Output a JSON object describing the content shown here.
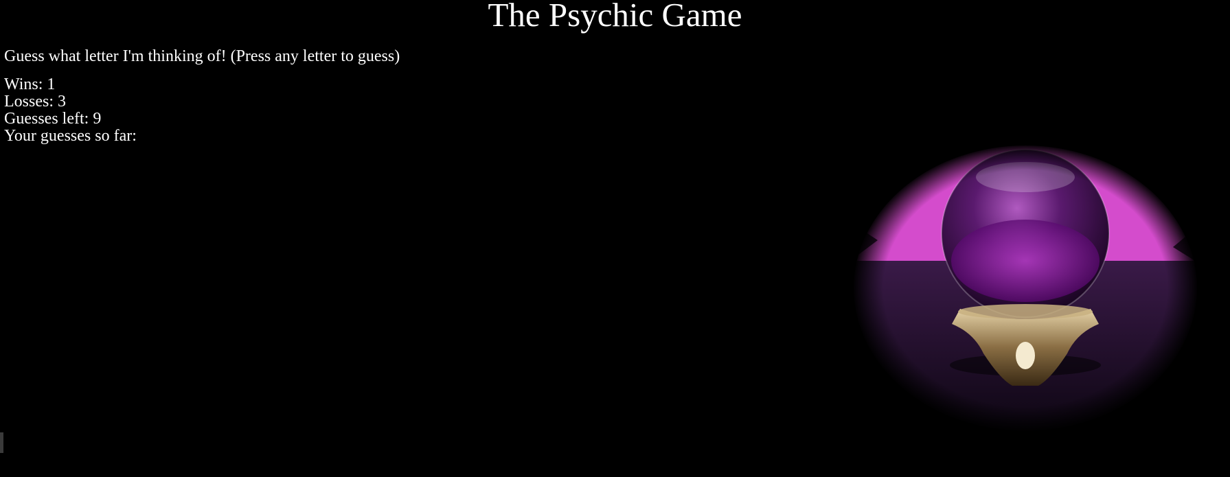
{
  "header": {
    "title": "The Psychic Game"
  },
  "game": {
    "instructions": "Guess what letter I'm thinking of! (Press any letter to guess)",
    "wins_label": "Wins: ",
    "wins": "1",
    "losses_label": "Losses: ",
    "losses": "3",
    "guesses_left_label": "Guesses left: ",
    "guesses_left": "9",
    "guesses_so_far_label": "Your guesses so far:",
    "guesses_so_far": ""
  },
  "image": {
    "icon": "crystal-ball-icon",
    "colors": {
      "backdrop": "#d94fd0",
      "sphere": "#7a1f8f",
      "table": "#2a1235",
      "stand": "#b89a6a"
    }
  }
}
